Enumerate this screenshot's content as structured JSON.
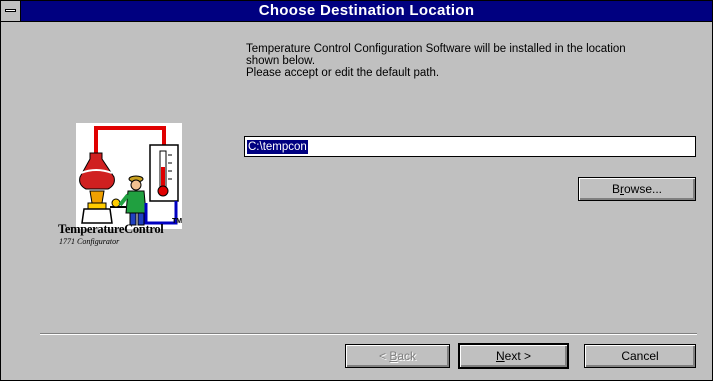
{
  "window": {
    "title": "Choose Destination Location"
  },
  "instructions": {
    "line1": "Temperature Control Configuration Software will be installed in the location",
    "line2": "shown below.",
    "line3": "Please accept or edit the default path."
  },
  "logo": {
    "icon": "temperature-control-logo-icon",
    "trademark": "TM",
    "brand": "TemperatureControl",
    "subtitle": "1771 Configurator"
  },
  "destination": {
    "path_value": "C:\\tempcon"
  },
  "buttons": {
    "browse": {
      "prefix": "B",
      "accel": "r",
      "suffix": "owse..."
    },
    "back": {
      "prefix": "< ",
      "accel": "B",
      "suffix": "ack",
      "enabled": false
    },
    "next": {
      "prefix": "",
      "accel": "N",
      "suffix": "ext >",
      "default": true
    },
    "cancel": {
      "label": "Cancel"
    }
  },
  "colors": {
    "titlebar": "#000080",
    "face": "#c0c0c0",
    "selection": "#000080"
  }
}
